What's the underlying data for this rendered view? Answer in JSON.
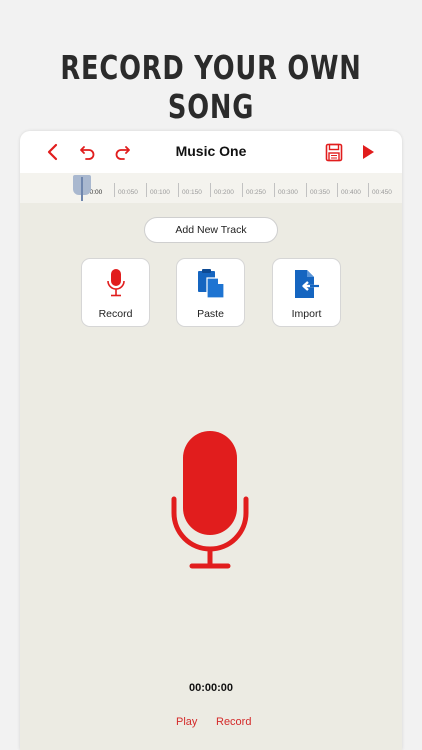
{
  "headline": "RECORD YOUR OWN SONG",
  "toolbar": {
    "title": "Music One",
    "icons": [
      "back-icon",
      "undo-icon",
      "redo-icon",
      "save-icon",
      "play-icon"
    ]
  },
  "timeline": {
    "ticks": [
      "00:00",
      "00:050",
      "00:100",
      "00:150",
      "00:200",
      "00:250",
      "00:300",
      "00:350",
      "00:400",
      "00:450"
    ]
  },
  "add_track_label": "Add New Track",
  "actions": [
    {
      "label": "Record",
      "icon": "microphone-icon"
    },
    {
      "label": "Paste",
      "icon": "paste-icon"
    },
    {
      "label": "Import",
      "icon": "import-icon"
    }
  ],
  "timer": "00:00:00",
  "bottom": {
    "play_label": "Play",
    "record_label": "Record"
  },
  "colors": {
    "accent": "#e11d1d",
    "blue": "#1565c0",
    "background": "#ecebe3"
  }
}
